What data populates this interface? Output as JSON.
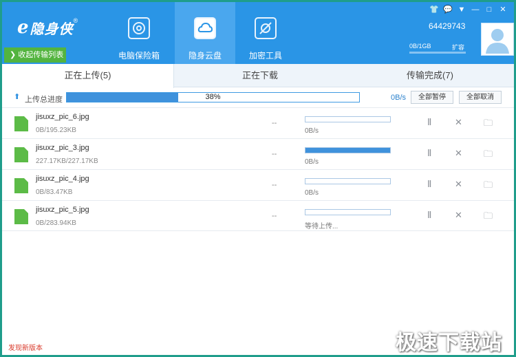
{
  "app": {
    "logo_mark": "e",
    "logo_text": "隐身侠",
    "logo_sup": "®",
    "collapse_label": "收起传输列表"
  },
  "nav": [
    {
      "label": "电脑保险箱",
      "icon": "safe-icon",
      "active": false
    },
    {
      "label": "隐身云盘",
      "icon": "cloud-disk-icon",
      "active": true
    },
    {
      "label": "加密工具",
      "icon": "encrypt-tool-icon",
      "active": false
    }
  ],
  "window_controls": {
    "shirt": "👕",
    "msg": "💬",
    "menu": "▼",
    "min": "—",
    "max": "□",
    "close": "✕"
  },
  "user": {
    "id": "64429743",
    "storage": "0B/1GB",
    "expand": "扩容"
  },
  "tabs": [
    {
      "label": "正在上传(5)",
      "active": true
    },
    {
      "label": "正在下载",
      "active": false
    },
    {
      "label": "传输完成(7)",
      "active": false
    }
  ],
  "upload_progress": {
    "label": "上传总进度",
    "percent_text": "38%",
    "percent": 38,
    "speed": "0B/s",
    "pause_all": "全部暂停",
    "cancel_all": "全部取消"
  },
  "files": [
    {
      "name": "jisuxz_pic_6.jpg",
      "size": "0B/195.23KB",
      "dash": "--",
      "progress": 0,
      "status": "0B/s"
    },
    {
      "name": "jisuxz_pic_3.jpg",
      "size": "227.17KB/227.17KB",
      "dash": "--",
      "progress": 100,
      "status": "0B/s"
    },
    {
      "name": "jisuxz_pic_4.jpg",
      "size": "0B/83.47KB",
      "dash": "--",
      "progress": 0,
      "status": "0B/s"
    },
    {
      "name": "jisuxz_pic_5.jpg",
      "size": "0B/283.94KB",
      "dash": "--",
      "progress": 0,
      "status": "等待上传..."
    }
  ],
  "row_actions": {
    "pause": "Ⅱ",
    "cancel": "✕",
    "folder": "🗀"
  },
  "footer": {
    "new_version": "发现新版本"
  },
  "watermark": "极速下载站",
  "colors": {
    "header": "#2a95e6",
    "accent": "#3f92dc",
    "green": "#53b43f",
    "alert": "#d93a2b"
  }
}
